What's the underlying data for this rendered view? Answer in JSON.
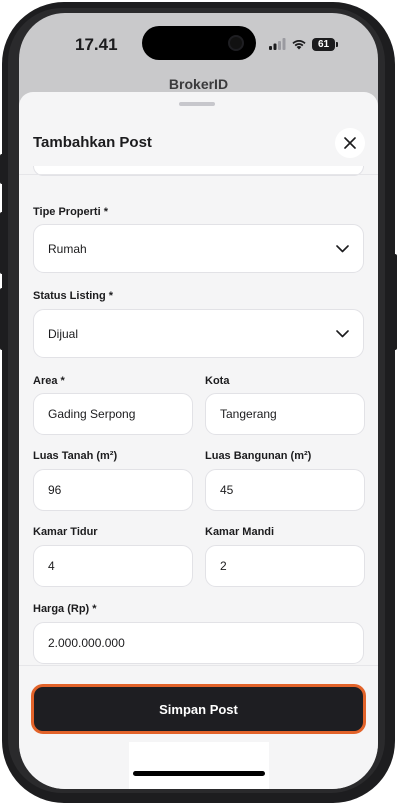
{
  "status_bar": {
    "time": "17.41",
    "battery": "61"
  },
  "background_app": {
    "title": "BrokerID"
  },
  "sheet": {
    "title": "Tambahkan Post",
    "fields": {
      "property_type": {
        "label": "Tipe Properti *",
        "value": "Rumah"
      },
      "listing_status": {
        "label": "Status Listing *",
        "value": "Dijual"
      },
      "area": {
        "label": "Area *",
        "value": "Gading Serpong"
      },
      "city": {
        "label": "Kota",
        "value": "Tangerang"
      },
      "land_area": {
        "label": "Luas Tanah (m²)",
        "value": "96"
      },
      "building_area": {
        "label": "Luas Bangunan (m²)",
        "value": "45"
      },
      "bedrooms": {
        "label": "Kamar Tidur",
        "value": "4"
      },
      "bathrooms": {
        "label": "Kamar Mandi",
        "value": "2"
      },
      "price": {
        "label": "Harga (Rp) *",
        "value": "2.000.000.000"
      }
    },
    "save_label": "Simpan Post"
  },
  "colors": {
    "accent_border": "#e2632a",
    "button_bg": "#1e1e22"
  }
}
